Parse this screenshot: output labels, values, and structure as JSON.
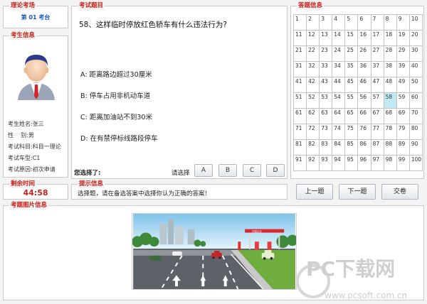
{
  "exam_area": {
    "title": "理论考场",
    "seat": "第 01 考台"
  },
  "candidate": {
    "title": "考生信息",
    "rows": [
      {
        "label": "考生姓名:",
        "value": "张三"
      },
      {
        "label": "性    别:",
        "value": "男"
      },
      {
        "label": "考试科目:",
        "value": "科目一理论"
      },
      {
        "label": "考试车型:",
        "value": "C1"
      },
      {
        "label": "考试原因:",
        "value": "初次申请"
      }
    ]
  },
  "timer": {
    "title": "剩余时间",
    "value": "44:58"
  },
  "question": {
    "title": "考试题目",
    "text": "58、这样临时停放红色轿车有什么违法行为?",
    "options": [
      "A: 距离路边超过30厘米",
      "B: 停车占用非机动车道",
      "C: 距离加油站不到30米",
      "D: 在有禁停标线路段停车"
    ],
    "your_answer_label": "您选择了:",
    "choose_label": "请选择",
    "answer_buttons": [
      "A",
      "B",
      "C",
      "D"
    ]
  },
  "answer_grid": {
    "title": "答题信息",
    "columns": 10,
    "total": 100,
    "current": 58
  },
  "hint": {
    "title": "提示信息",
    "text": "选择题，请在备选答案中选择你认为正确的答案！"
  },
  "nav": {
    "prev": "上一题",
    "next": "下一题",
    "submit": "交卷"
  },
  "image_panel": {
    "title": "考题图片信息"
  },
  "scene_sign": "中国石化",
  "watermark": {
    "brand": "PC下载网",
    "url": "www.pcsoft.com.cn"
  },
  "colors": {
    "accent_red": "#c8201a",
    "seat_blue": "#1f56b8",
    "current_cell": "#bfeaf3"
  }
}
